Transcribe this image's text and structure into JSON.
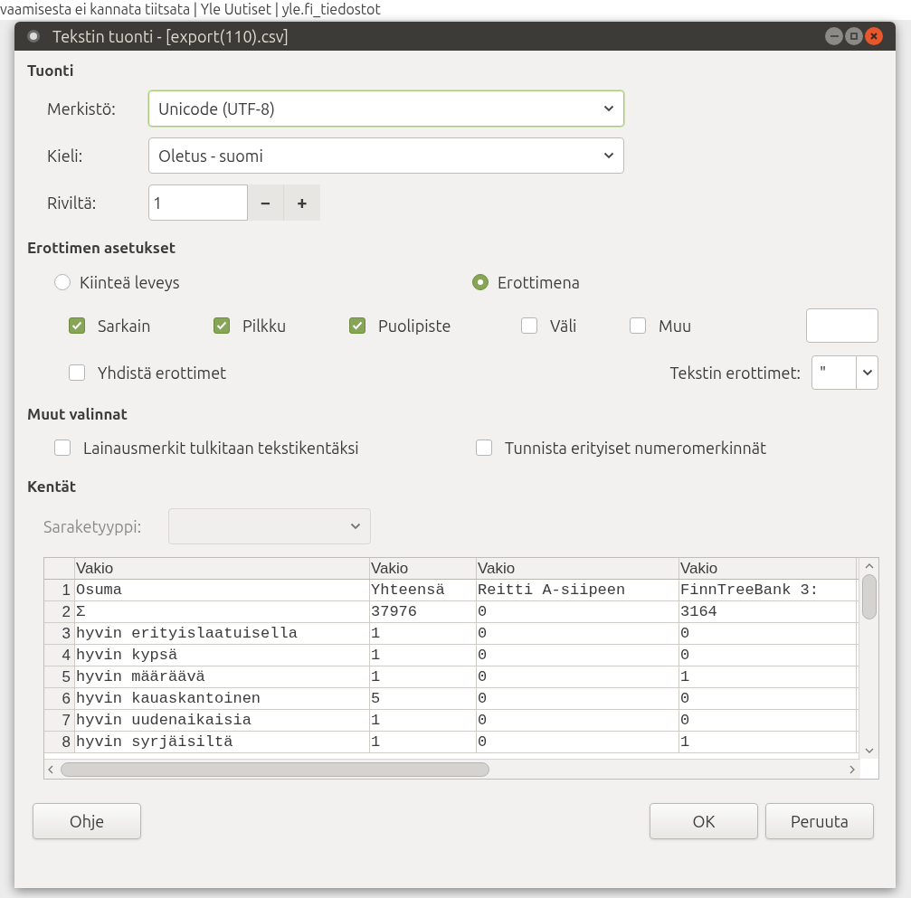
{
  "background_window": {
    "title": "vaamisesta ei kannata tiitsata | Yle Uutiset | yle.fi_tiedostot"
  },
  "window": {
    "title": "Tekstin tuonti - [export(110).csv]"
  },
  "import": {
    "heading": "Tuonti",
    "charset": {
      "label": "Merkistö:",
      "value": "Unicode (UTF-8)",
      "focused": true
    },
    "language": {
      "label": "Kieli:",
      "value": "Oletus - suomi",
      "focused": false
    },
    "from_row": {
      "label": "Riviltä:",
      "value": "1",
      "minus": "−",
      "plus": "+"
    }
  },
  "separator_options": {
    "heading": "Erottimen asetukset",
    "modes": [
      {
        "label": "Kiinteä leveys",
        "selected": false
      },
      {
        "label": "Erottimena",
        "selected": true
      }
    ],
    "separators": [
      {
        "label": "Sarkain",
        "checked": true
      },
      {
        "label": "Pilkku",
        "checked": true
      },
      {
        "label": "Puolipiste",
        "checked": true
      },
      {
        "label": "Väli",
        "checked": false
      },
      {
        "label": "Muu",
        "checked": false
      }
    ],
    "merge": {
      "label": "Yhdistä erottimet",
      "checked": false
    },
    "text_delimiter": {
      "label": "Tekstin erottimet:",
      "value": "\""
    }
  },
  "other_options": {
    "heading": "Muut valinnat",
    "options": [
      {
        "label": "Lainausmerkit tulkitaan tekstikentäksi",
        "checked": false
      },
      {
        "label": "Tunnista erityiset numeromerkinnät",
        "checked": false
      }
    ]
  },
  "fields": {
    "heading": "Kentät",
    "column_type": {
      "label": "Saraketyyppi:",
      "disabled": true
    },
    "table": {
      "columns": [
        "Vakio",
        "Vakio",
        "Vakio",
        "Vakio"
      ],
      "rows": [
        {
          "number": "1",
          "cells": [
            "Osuma",
            "Yhteensä",
            "Reitti A-siipeen",
            "FinnTreeBank 3:"
          ]
        },
        {
          "number": "2",
          "cells": [
            "Σ",
            "37976",
            "0",
            "3164"
          ]
        },
        {
          "number": "3",
          "cells": [
            "hyvin erityislaatuisella",
            "1",
            "0",
            "0"
          ]
        },
        {
          "number": "4",
          "cells": [
            "hyvin kypsä",
            "1",
            "0",
            "0"
          ]
        },
        {
          "number": "5",
          "cells": [
            "hyvin määräävä",
            "1",
            "0",
            "1"
          ]
        },
        {
          "number": "6",
          "cells": [
            "hyvin kauaskantoinen",
            "5",
            "0",
            "0"
          ]
        },
        {
          "number": "7",
          "cells": [
            "hyvin uudenaikaisia",
            "1",
            "0",
            "0"
          ]
        },
        {
          "number": "8",
          "cells": [
            "hyvin syrjäisiltä",
            "1",
            "0",
            "1"
          ]
        }
      ]
    }
  },
  "buttons": {
    "help": "Ohje",
    "ok": "OK",
    "cancel": "Peruuta"
  }
}
